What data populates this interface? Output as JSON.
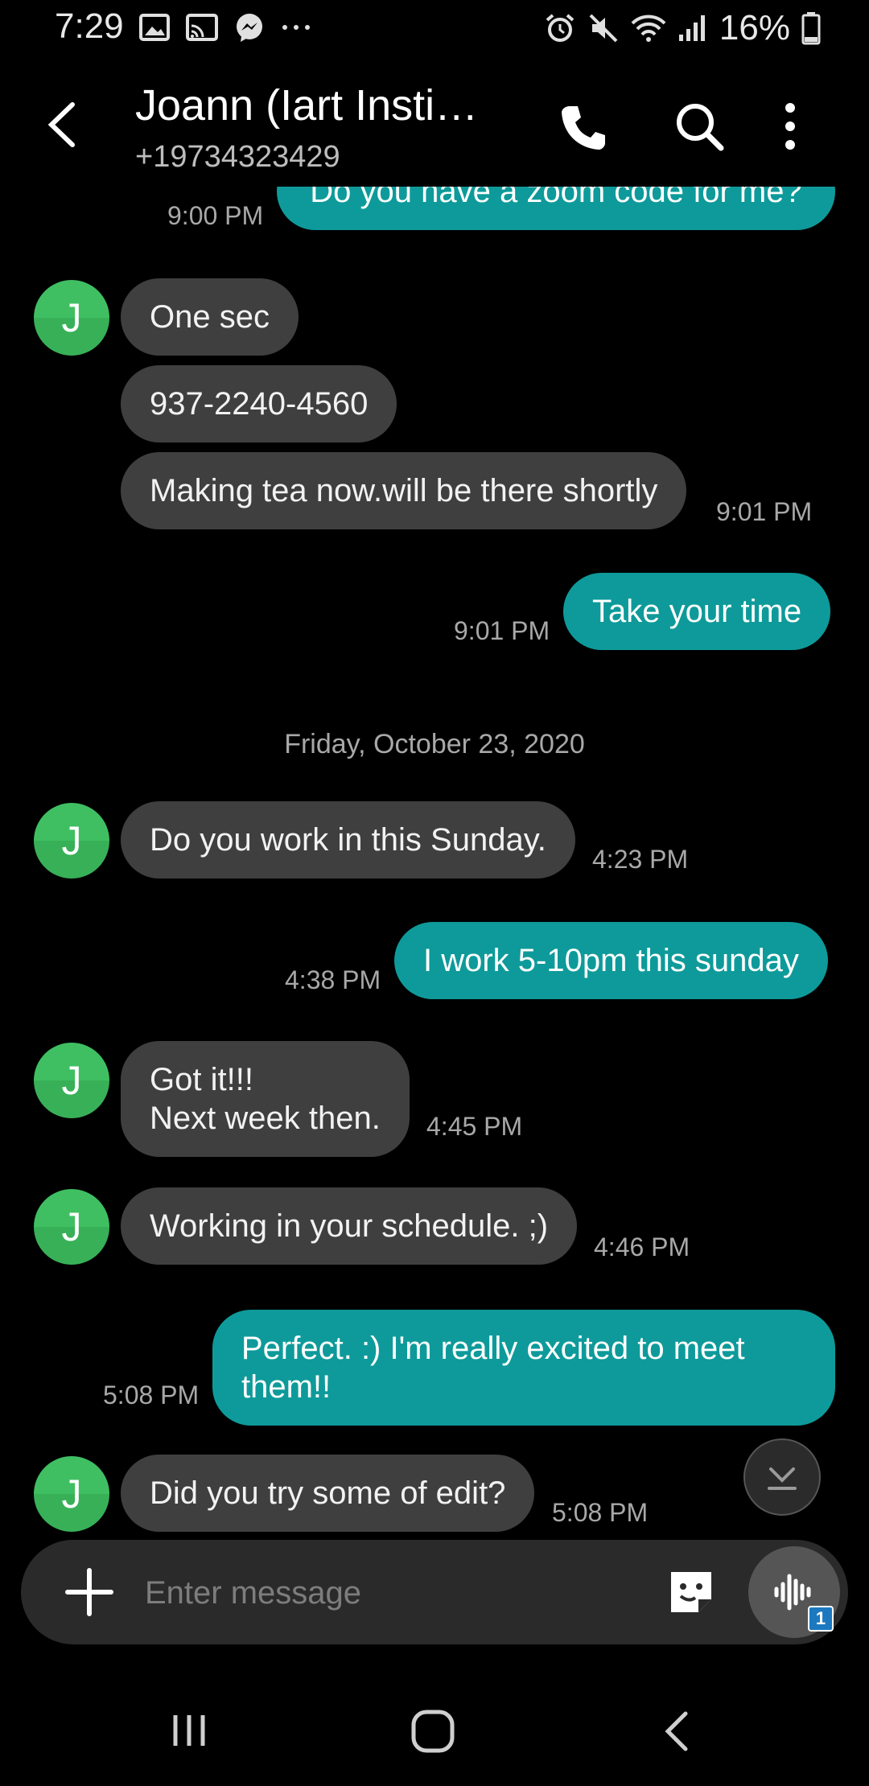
{
  "status_bar": {
    "time": "7:29",
    "battery_percent": "16%",
    "icons_left": [
      "gallery-icon",
      "cast-icon",
      "messenger-icon",
      "more-notifications-icon"
    ],
    "icons_right": [
      "alarm-icon",
      "mute-icon",
      "wifi-icon",
      "signal-icon",
      "battery-icon"
    ]
  },
  "header": {
    "title": "Joann (Iart Insti…",
    "phone": "+19734323429"
  },
  "conversation": {
    "m1_text": "Do you have a zoom code for me?",
    "m1_time": "9:00 PM",
    "m2_text": "One sec",
    "m3_text": "937-2240-4560",
    "m4_text": "Making tea now.will be there shortly",
    "m4_time": "9:01 PM",
    "m5_text": "Take your time",
    "m5_time": "9:01 PM",
    "date_separator": "Friday, October 23, 2020",
    "m6_text": "Do you work in this Sunday.",
    "m6_time": "4:23 PM",
    "m7_text": "I work 5-10pm this sunday",
    "m7_time": "4:38 PM",
    "m8_text": "Got it!!!\nNext week then.",
    "m8_time": "4:45 PM",
    "m9_text": "Working in your schedule. ;)",
    "m9_time": "4:46 PM",
    "m10_text": "Perfect. :) I'm really excited to meet them!!",
    "m10_time": "5:08 PM",
    "m11_text": "Did you try some of edit?",
    "m11_time": "5:08 PM",
    "avatar_letter": "J"
  },
  "composer": {
    "placeholder": "Enter message",
    "voice_badge": "1"
  },
  "colors": {
    "outgoing_bubble": "#0e9a9a",
    "incoming_bubble": "#3f3f3f",
    "avatar": "#3fbf62",
    "background": "#000000"
  }
}
